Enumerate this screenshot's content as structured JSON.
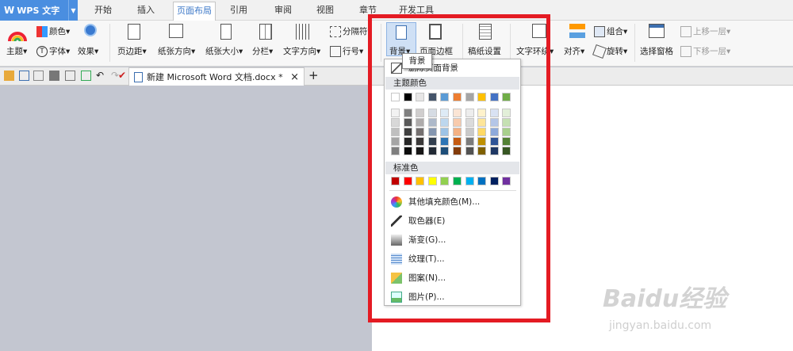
{
  "app": {
    "title": "WPS 文字"
  },
  "tabs": [
    "开始",
    "插入",
    "页面布局",
    "引用",
    "审阅",
    "视图",
    "章节",
    "开发工具"
  ],
  "ribbon": {
    "theme": "主题",
    "colors": "颜色",
    "fonts": "字体",
    "effects": "效果",
    "margins": "页边距",
    "orientation": "纸张方向",
    "size": "纸张大小",
    "columns": "分栏",
    "text_direction": "文字方向",
    "breaks": "分隔符",
    "line_numbers": "行号",
    "background": "背景",
    "page_border": "页面边框",
    "paper_settings": "稿纸设置",
    "wrap": "文字环绕",
    "align": "对齐",
    "group": "组合",
    "rotate": "旋转",
    "selection_pane": "选择窗格",
    "bring_forward": "上移一层",
    "send_backward": "下移一层"
  },
  "doc_tab": {
    "label": "新建 Microsoft Word 文档.docx *",
    "close": "×",
    "new": "+"
  },
  "tooltip": "背景",
  "menu": {
    "delete_background": "删除页面背景",
    "theme_colors_header": "主题颜色",
    "standard_colors_header": "标准色",
    "theme_top_row": [
      "#ffffff",
      "#000000",
      "#e7e6e6",
      "#44546a",
      "#5b9bd5",
      "#ed7d31",
      "#a5a5a5",
      "#ffc000",
      "#4472c4",
      "#70ad47"
    ],
    "theme_shades": [
      [
        "#f2f2f2",
        "#7f7f7f",
        "#d0cece",
        "#d6dce4",
        "#deebf6",
        "#fbe5d5",
        "#ededed",
        "#fff2cc",
        "#d9e2f3",
        "#e2efd9"
      ],
      [
        "#d8d8d8",
        "#595959",
        "#aeabab",
        "#adb9ca",
        "#bdd7ee",
        "#f8cbad",
        "#dbdbdb",
        "#fee599",
        "#b4c6e7",
        "#c5e0b3"
      ],
      [
        "#bfbfbf",
        "#3f3f3f",
        "#757070",
        "#8496b0",
        "#9dc3e6",
        "#f4b183",
        "#c9c9c9",
        "#ffd965",
        "#8eaadb",
        "#a8d08d"
      ],
      [
        "#a5a5a5",
        "#262626",
        "#3a3838",
        "#323f4f",
        "#2e75b5",
        "#c55a11",
        "#7b7b7b",
        "#bf9000",
        "#2f5496",
        "#538135"
      ],
      [
        "#7f7f7f",
        "#0c0c0c",
        "#171616",
        "#222a35",
        "#1e4e79",
        "#833c0b",
        "#525252",
        "#7f6000",
        "#1f3864",
        "#375623"
      ]
    ],
    "standard_colors": [
      "#c00000",
      "#ff0000",
      "#ffc000",
      "#ffff00",
      "#92d050",
      "#00b050",
      "#00b0f0",
      "#0070c0",
      "#002060",
      "#7030a0"
    ],
    "items": [
      {
        "label": "其他填充颜色(M)...",
        "icon": "color-wheel-icon"
      },
      {
        "label": "取色器(E)",
        "icon": "eyedropper-icon"
      },
      {
        "label": "渐变(G)...",
        "icon": "gradient-icon"
      },
      {
        "label": "纹理(T)...",
        "icon": "texture-icon"
      },
      {
        "label": "图案(N)...",
        "icon": "pattern-icon"
      },
      {
        "label": "图片(P)...",
        "icon": "picture-icon"
      }
    ]
  },
  "watermark": {
    "logo": "Baidu经验",
    "url": "jingyan.baidu.com"
  },
  "colors": {
    "accent": "#4a8ee0",
    "highlight": "#e41b23"
  }
}
